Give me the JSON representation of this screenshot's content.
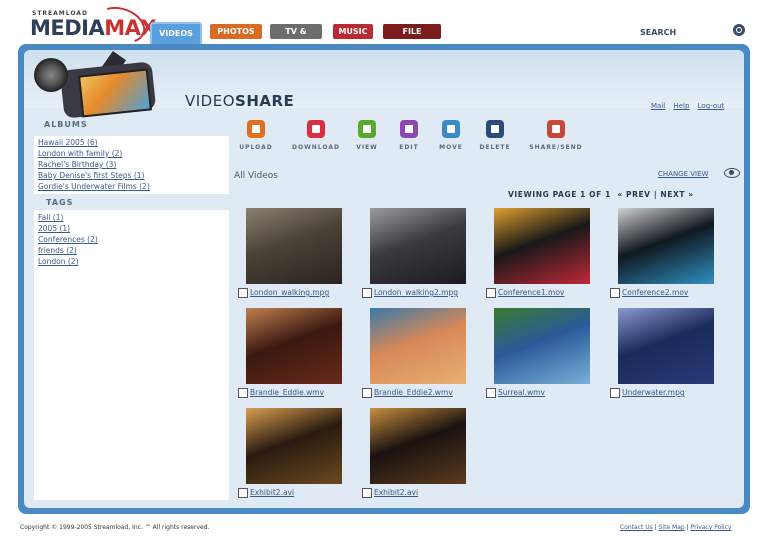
{
  "header": {
    "logo_small": "STREAMLOAD",
    "logo_media": "MEDIA",
    "logo_max": "MAX",
    "tabs": [
      "VIDEOS",
      "PHOTOS",
      "TV & MOVIE",
      "MUSIC",
      "FILE MANAGE"
    ],
    "search_label": "SEARCH"
  },
  "section": {
    "title_light": "VIDEO",
    "title_bold": "SHARE",
    "links": [
      "Mail",
      "Help",
      "Log-out"
    ]
  },
  "sidebar": {
    "albums_title": "ALBUMS",
    "albums": [
      "Hawaii 2005 (6)",
      "London with family (2)",
      "Rachel's Birthday (3)",
      "Baby Denise's first Steps (1)",
      "Gordie's Underwater Films (2)"
    ],
    "tags_title": "TAGS",
    "tags": [
      "Fall (1)",
      "2005 (1)",
      "Conferences (2)",
      "friends (2)",
      "London (2)"
    ]
  },
  "toolbar": [
    {
      "label": "UPLOAD",
      "icon": "upload-icon",
      "color": "#e07020"
    },
    {
      "label": "DOWNLOAD",
      "icon": "download-icon",
      "color": "#d83040"
    },
    {
      "label": "VIEW",
      "icon": "play-icon",
      "color": "#5aa830"
    },
    {
      "label": "EDIT",
      "icon": "edit-icon",
      "color": "#8a48b0"
    },
    {
      "label": "MOVE",
      "icon": "move-icon",
      "color": "#3a8ac8"
    },
    {
      "label": "DELETE",
      "icon": "trash-icon",
      "color": "#2a4a78"
    },
    {
      "label": "SHARE/SEND",
      "icon": "share-icon",
      "color": "#c84838"
    }
  ],
  "main": {
    "heading": "All Videos",
    "change_view": "CHANGE VIEW",
    "paging_prefix": "VIEWING PAGE 1 OF 1",
    "prev": "« PREV",
    "separator": "|",
    "next": "NEXT »"
  },
  "videos": [
    {
      "name": "London_walking.mpg",
      "colors": [
        "#4a4238",
        "#2a2420",
        "#8a8070"
      ]
    },
    {
      "name": "London_walking2.mpg",
      "colors": [
        "#3a3a40",
        "#1a1a20",
        "#9a9aa0"
      ]
    },
    {
      "name": "Conference1.mov",
      "colors": [
        "#181818",
        "#c02838",
        "#e0a030"
      ]
    },
    {
      "name": "Conference2.mov",
      "colors": [
        "#101820",
        "#3090c0",
        "#d0d0d0"
      ]
    },
    {
      "name": "Brandie_Eddie.wmv",
      "colors": [
        "#3a1810",
        "#6a2a1a",
        "#c08050"
      ]
    },
    {
      "name": "Brandie_Eddie2.wmv",
      "colors": [
        "#d88858",
        "#e8b070",
        "#3a7aa8"
      ]
    },
    {
      "name": "Surreal.wmv",
      "colors": [
        "#2a5a9a",
        "#7ab0d8",
        "#3a7a30"
      ]
    },
    {
      "name": "Underwater.mpg",
      "colors": [
        "#1a2a5a",
        "#2a3a7a",
        "#8a9ad0"
      ]
    },
    {
      "name": "Exhibit2.avi",
      "colors": [
        "#2a1a10",
        "#6a4a20",
        "#d8a050"
      ]
    },
    {
      "name": "Exhibit2.avi",
      "colors": [
        "#1a1210",
        "#5a3a20",
        "#c89040"
      ]
    }
  ],
  "footer": {
    "copyright": "Copyright © 1999-2005 Streamload, Inc. ™ All rights reserved.",
    "links": [
      "Contact Us",
      "Site Map",
      "Privacy Policy"
    ],
    "separator": " | "
  }
}
